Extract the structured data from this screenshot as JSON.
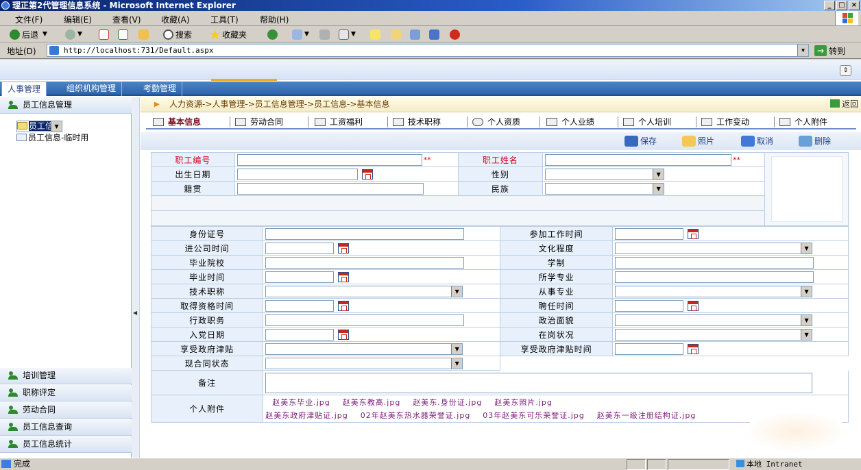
{
  "window": {
    "title": "理正第2代管理信息系统 - Microsoft Internet Explorer",
    "controls": [
      "_",
      "□",
      "×"
    ]
  },
  "menu": [
    "文件(F)",
    "编辑(E)",
    "查看(V)",
    "收藏(A)",
    "工具(T)",
    "帮助(H)"
  ],
  "toolbar": {
    "back": "后退",
    "search": "搜索",
    "favorites": "收藏夹"
  },
  "address": {
    "label": "地址(D)",
    "url": "http://localhost:731/Default.aspx",
    "go": "转到"
  },
  "main_tabs": [
    {
      "label": "人事管理",
      "active": true
    },
    {
      "label": "组织机构管理",
      "active": false
    },
    {
      "label": "考勤管理",
      "active": false
    }
  ],
  "sidebar": {
    "top_section": "员工信息管理",
    "tree": [
      {
        "label": "员工信息",
        "selected": true
      },
      {
        "label": "员工信息-临时用",
        "selected": false
      }
    ],
    "bottom_sections": [
      "培训管理",
      "职称评定",
      "劳动合同",
      "员工信息查询",
      "员工信息统计"
    ]
  },
  "breadcrumb": {
    "path": "人力资源->人事管理->员工信息管理->员工信息->基本信息",
    "back": "返回"
  },
  "subtabs": [
    "基本信息",
    "劳动合同",
    "工资福利",
    "技术职称",
    "个人资质",
    "个人业绩",
    "个人培训",
    "工作变动",
    "个人附件"
  ],
  "actions": {
    "save": "保存",
    "photo": "照片",
    "cancel": "取消",
    "delete": "删除"
  },
  "form": {
    "emp_no": "职工编号",
    "emp_name": "职工姓名",
    "required_mark": "**",
    "birth_date": "出生日期",
    "gender": "性别",
    "native_place": "籍贯",
    "ethnicity": "民族",
    "id_number": "身份证号",
    "work_start": "参加工作时间",
    "join_date": "进公司时间",
    "education": "文化程度",
    "school": "毕业院校",
    "schooling": "学制",
    "grad_date": "毕业时间",
    "major": "所学专业",
    "tech_title": "技术职称",
    "profession": "从事专业",
    "qual_date": "取得资格时间",
    "hire_date": "聘任时间",
    "admin_post": "行政职务",
    "political": "政治面貌",
    "party_date": "入党日期",
    "post_status": "在岗状况",
    "allowance": "享受政府津贴",
    "allowance_date": "享受政府津贴时间",
    "contract_status": "现合同状态",
    "remark": "备注",
    "attachments_label": "个人附件"
  },
  "attachments": [
    "赵美东毕业.jpg",
    "赵美东教高.jpg",
    "赵美东.身份证.jpg",
    "赵美东照片.jpg",
    "赵美东政府津贴证.jpg",
    "02年赵美东热水器荣誉证.jpg",
    "03年赵美东可乐荣誉证.jpg",
    "赵美东一级注册结构证.jpg"
  ],
  "status": {
    "left": "完成",
    "zone": "本地 Intranet"
  }
}
